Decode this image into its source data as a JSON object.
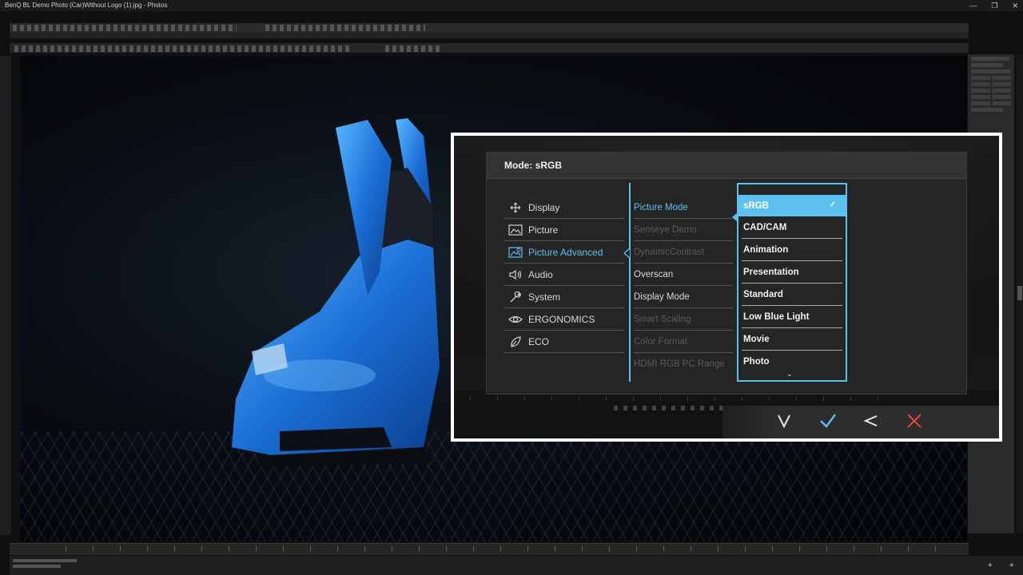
{
  "window": {
    "title": "BenQ BL Demo Photo (Car)Without Logo (1).jpg - Photos",
    "minimize": "—",
    "maximize": "❐",
    "close": "✕"
  },
  "osd": {
    "mode_title": "Mode: sRGB",
    "main_menu": [
      {
        "label": "Display",
        "icon": "move-arrows-icon",
        "active": false
      },
      {
        "label": "Picture",
        "icon": "picture-icon",
        "active": false
      },
      {
        "label": "Picture Advanced",
        "icon": "picture-advanced-icon",
        "active": true
      },
      {
        "label": "Audio",
        "icon": "speaker-icon",
        "active": false
      },
      {
        "label": "System",
        "icon": "wrench-icon",
        "active": false
      },
      {
        "label": "ERGONOMICS",
        "icon": "eye-icon",
        "active": false
      },
      {
        "label": "ECO",
        "icon": "leaf-icon",
        "active": false
      }
    ],
    "sub_menu": [
      {
        "label": "Picture Mode",
        "state": "active"
      },
      {
        "label": "Senseye Demo",
        "state": "disabled"
      },
      {
        "label": "DynamicContrast",
        "state": "disabled"
      },
      {
        "label": "Overscan",
        "state": "normal"
      },
      {
        "label": "Display Mode",
        "state": "normal"
      },
      {
        "label": "Smart Scaling",
        "state": "disabled"
      },
      {
        "label": "Color Format",
        "state": "disabled"
      },
      {
        "label": "HDMI RGB PC Range",
        "state": "disabled"
      }
    ],
    "options": [
      {
        "label": "sRGB",
        "selected": true
      },
      {
        "label": "CAD/CAM",
        "selected": false
      },
      {
        "label": "Animation",
        "selected": false
      },
      {
        "label": "Presentation",
        "selected": false
      },
      {
        "label": "Standard",
        "selected": false
      },
      {
        "label": "Low Blue Light",
        "selected": false
      },
      {
        "label": "Movie",
        "selected": false
      },
      {
        "label": "Photo",
        "selected": false
      }
    ],
    "check_glyph": "✓",
    "more_glyph": "⌄",
    "hotkeys": [
      {
        "name": "down-key",
        "icon": "chevron-down-icon"
      },
      {
        "name": "confirm-key",
        "icon": "check-icon"
      },
      {
        "name": "back-key",
        "icon": "chevron-left-icon"
      },
      {
        "name": "exit-key",
        "icon": "close-icon"
      }
    ]
  },
  "colors": {
    "accent": "#5dc1f0",
    "exit": "#d9453a",
    "menu_bg": "#252525"
  }
}
